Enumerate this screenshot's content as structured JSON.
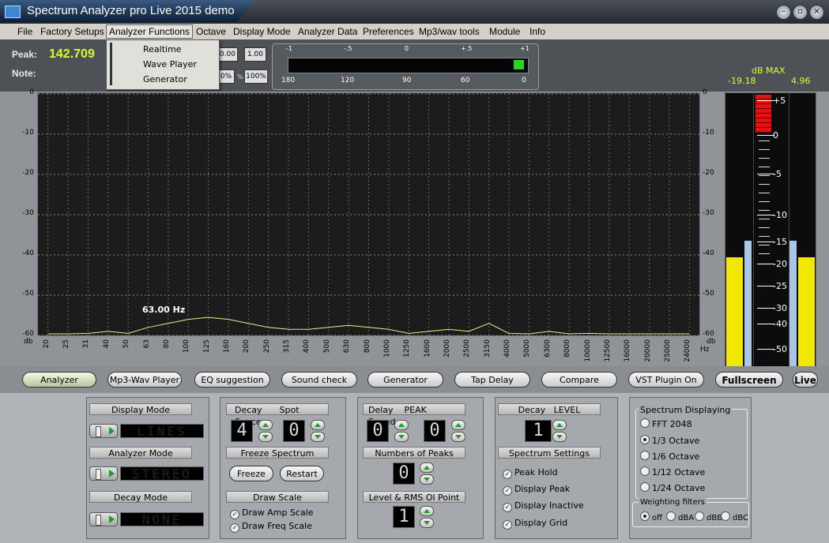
{
  "window": {
    "title": "Spectrum Analyzer pro Live 2015 demo"
  },
  "menu": [
    "File",
    "Factory Setups",
    "Analyzer Functions",
    "Octave",
    "Display Mode",
    "Analyzer Data",
    "Preferences",
    "Mp3/wav tools",
    "Module",
    "Info"
  ],
  "dropdown": [
    "Realtime",
    "Wave Player",
    "Generator"
  ],
  "peak": {
    "label": "Peak:",
    "value": "142.709"
  },
  "note": {
    "label": "Note:"
  },
  "controls": {
    "val1": "0.00",
    "val2": "1.00",
    "val3": "0%",
    "pct": "%",
    "val4": "100%"
  },
  "meter": {
    "scale_top": [
      "-1",
      "-.5",
      "0",
      "+.5",
      "+1"
    ],
    "scale_bottom": [
      "180",
      "120",
      "90",
      "60",
      "0"
    ],
    "level": 0.03,
    "accent": "#2bd12b"
  },
  "dbmax": {
    "label": "dB MAX",
    "left": "-19.18",
    "right": "4.96"
  },
  "spectrum": {
    "ylabels": [
      "0",
      "-10",
      "-20",
      "-30",
      "-40",
      "-50",
      "-60"
    ],
    "unit": "db",
    "hz": "Hz",
    "freq_marker": "63.00 Hz",
    "xlabels": [
      "20",
      "25",
      "31",
      "40",
      "50",
      "63",
      "80",
      "100",
      "125",
      "160",
      "200",
      "250",
      "315",
      "400",
      "500",
      "630",
      "800",
      "1000",
      "1250",
      "1600",
      "2000",
      "2500",
      "3150",
      "4000",
      "5000",
      "6300",
      "8000",
      "10000",
      "12500",
      "16000",
      "20000",
      "25000",
      "24000"
    ],
    "curve_db": [
      -60,
      -60,
      -59.5,
      -59,
      -59.5,
      -58,
      -57,
      -56,
      -55.5,
      -56,
      -57,
      -58,
      -58.5,
      -58.5,
      -58,
      -57.5,
      -58,
      -58.5,
      -59.5,
      -59,
      -58.5,
      -59,
      -57,
      -59.5,
      -60,
      -59,
      -60,
      -59.5,
      -60,
      -60,
      -60,
      -60,
      -60
    ],
    "curve_color": "#ecec8c"
  },
  "vu": {
    "scale": [
      "+5",
      "0",
      "-5",
      "-10",
      "-15",
      "-20",
      "-25",
      "-30",
      "-40",
      "-50"
    ],
    "left_level": 0.4,
    "right_level": 0.4,
    "bar_color": "#f0e800",
    "peak_color": "#a9c6e8",
    "over_color": "#e81010"
  },
  "buttons": [
    "Analyzer",
    "Mp3-Wav Player",
    "EQ suggestion",
    "Sound check",
    "Generator",
    "Tap Delay",
    "Compare",
    "VST Plugin On",
    "Fullscreen",
    "Live"
  ],
  "panel1": {
    "display_mode": "Display Mode",
    "display_value": "LINES",
    "analyzer_mode": "Analyzer Mode",
    "analyzer_value": "STEREO",
    "decay_mode": "Decay Mode",
    "decay_value": "NONE"
  },
  "panel2": {
    "decay": "Decay",
    "spot_space": "Spot Space",
    "decay_value": "4",
    "spot_value": "0",
    "freeze_spectrum": "Freeze Spectrum",
    "freeze": "Freeze",
    "restart": "Restart",
    "draw_scale": "Draw Scale",
    "draw_amp": "Draw Amp Scale",
    "draw_freq": "Draw Freq Scale"
  },
  "panel3": {
    "delay": "Delay",
    "peak": "PEAK",
    "speed": "Speed",
    "delay_value": "0",
    "speed_value": "0",
    "num_peaks": "Numbers of Peaks",
    "num_peaks_value": "0",
    "level_rms": "Level & RMS Ol Point",
    "level_rms_value": "1"
  },
  "panel4": {
    "decay_level": "Decay   LEVEL",
    "level_value": "1",
    "spectrum_settings": "Spectrum Settings",
    "checks": [
      "Peak Hold",
      "Display Peak",
      "Display Inactive",
      "Display Grid"
    ]
  },
  "panel5": {
    "spectrum_displaying": "Spectrum Displaying",
    "options": [
      "FFT 2048",
      "1/3 Octave",
      "1/6 Octave",
      "1/12 Octave",
      "1/24 Octave"
    ],
    "selected": 1,
    "weighting": "Weighting filters",
    "weights": [
      "off",
      "dBA",
      "dBB",
      "dBC"
    ],
    "weight_selected": 0
  }
}
